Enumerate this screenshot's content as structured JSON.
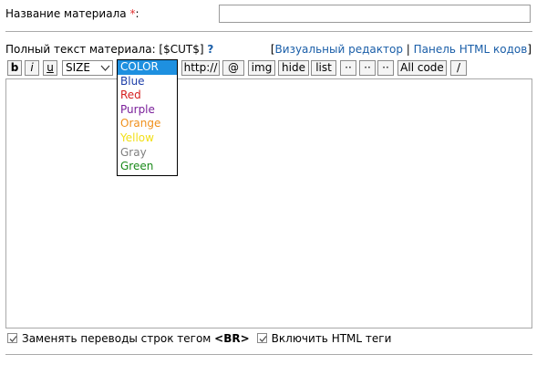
{
  "form": {
    "title_label": "Название материала",
    "required_mark": "*",
    "title_colon": ":",
    "title_value": "",
    "fulltext_label": "Полный текст материала: [$CUT$",
    "fulltext_close": "]",
    "help_mark": "?",
    "links": {
      "open": "[",
      "visual": "Визуальный редактор",
      "separator": "|",
      "html_panel": "Панель HTML кодов",
      "close": "]"
    },
    "editor_value": ""
  },
  "toolbar": {
    "bold": "b",
    "italic": "i",
    "underline": "u",
    "size_select": "SIZE",
    "http": "http://",
    "email": "@",
    "img": "img",
    "hide": "hide",
    "list": "list",
    "dots1": "··",
    "dots2": "··",
    "dots3": "··",
    "all_code": "All code",
    "slash": "/"
  },
  "color_dropdown": {
    "options": [
      {
        "label": "COLOR",
        "color": "#ffffff"
      },
      {
        "label": "Blue",
        "color": "#1c3ea8"
      },
      {
        "label": "Red",
        "color": "#d62020"
      },
      {
        "label": "Purple",
        "color": "#7a1f9a"
      },
      {
        "label": "Orange",
        "color": "#f0901c"
      },
      {
        "label": "Yellow",
        "color": "#f2e01a"
      },
      {
        "label": "Gray",
        "color": "#808080"
      },
      {
        "label": "Green",
        "color": "#1a8a1a"
      }
    ],
    "selected": "COLOR",
    "selected_bg": "#1e90e0"
  },
  "options": {
    "replace_br_label": "Заменять переводы строк тегом",
    "replace_br_tag": "<BR>",
    "replace_br_checked": true,
    "enable_html_label": "Включить HTML теги",
    "enable_html_checked": true
  }
}
